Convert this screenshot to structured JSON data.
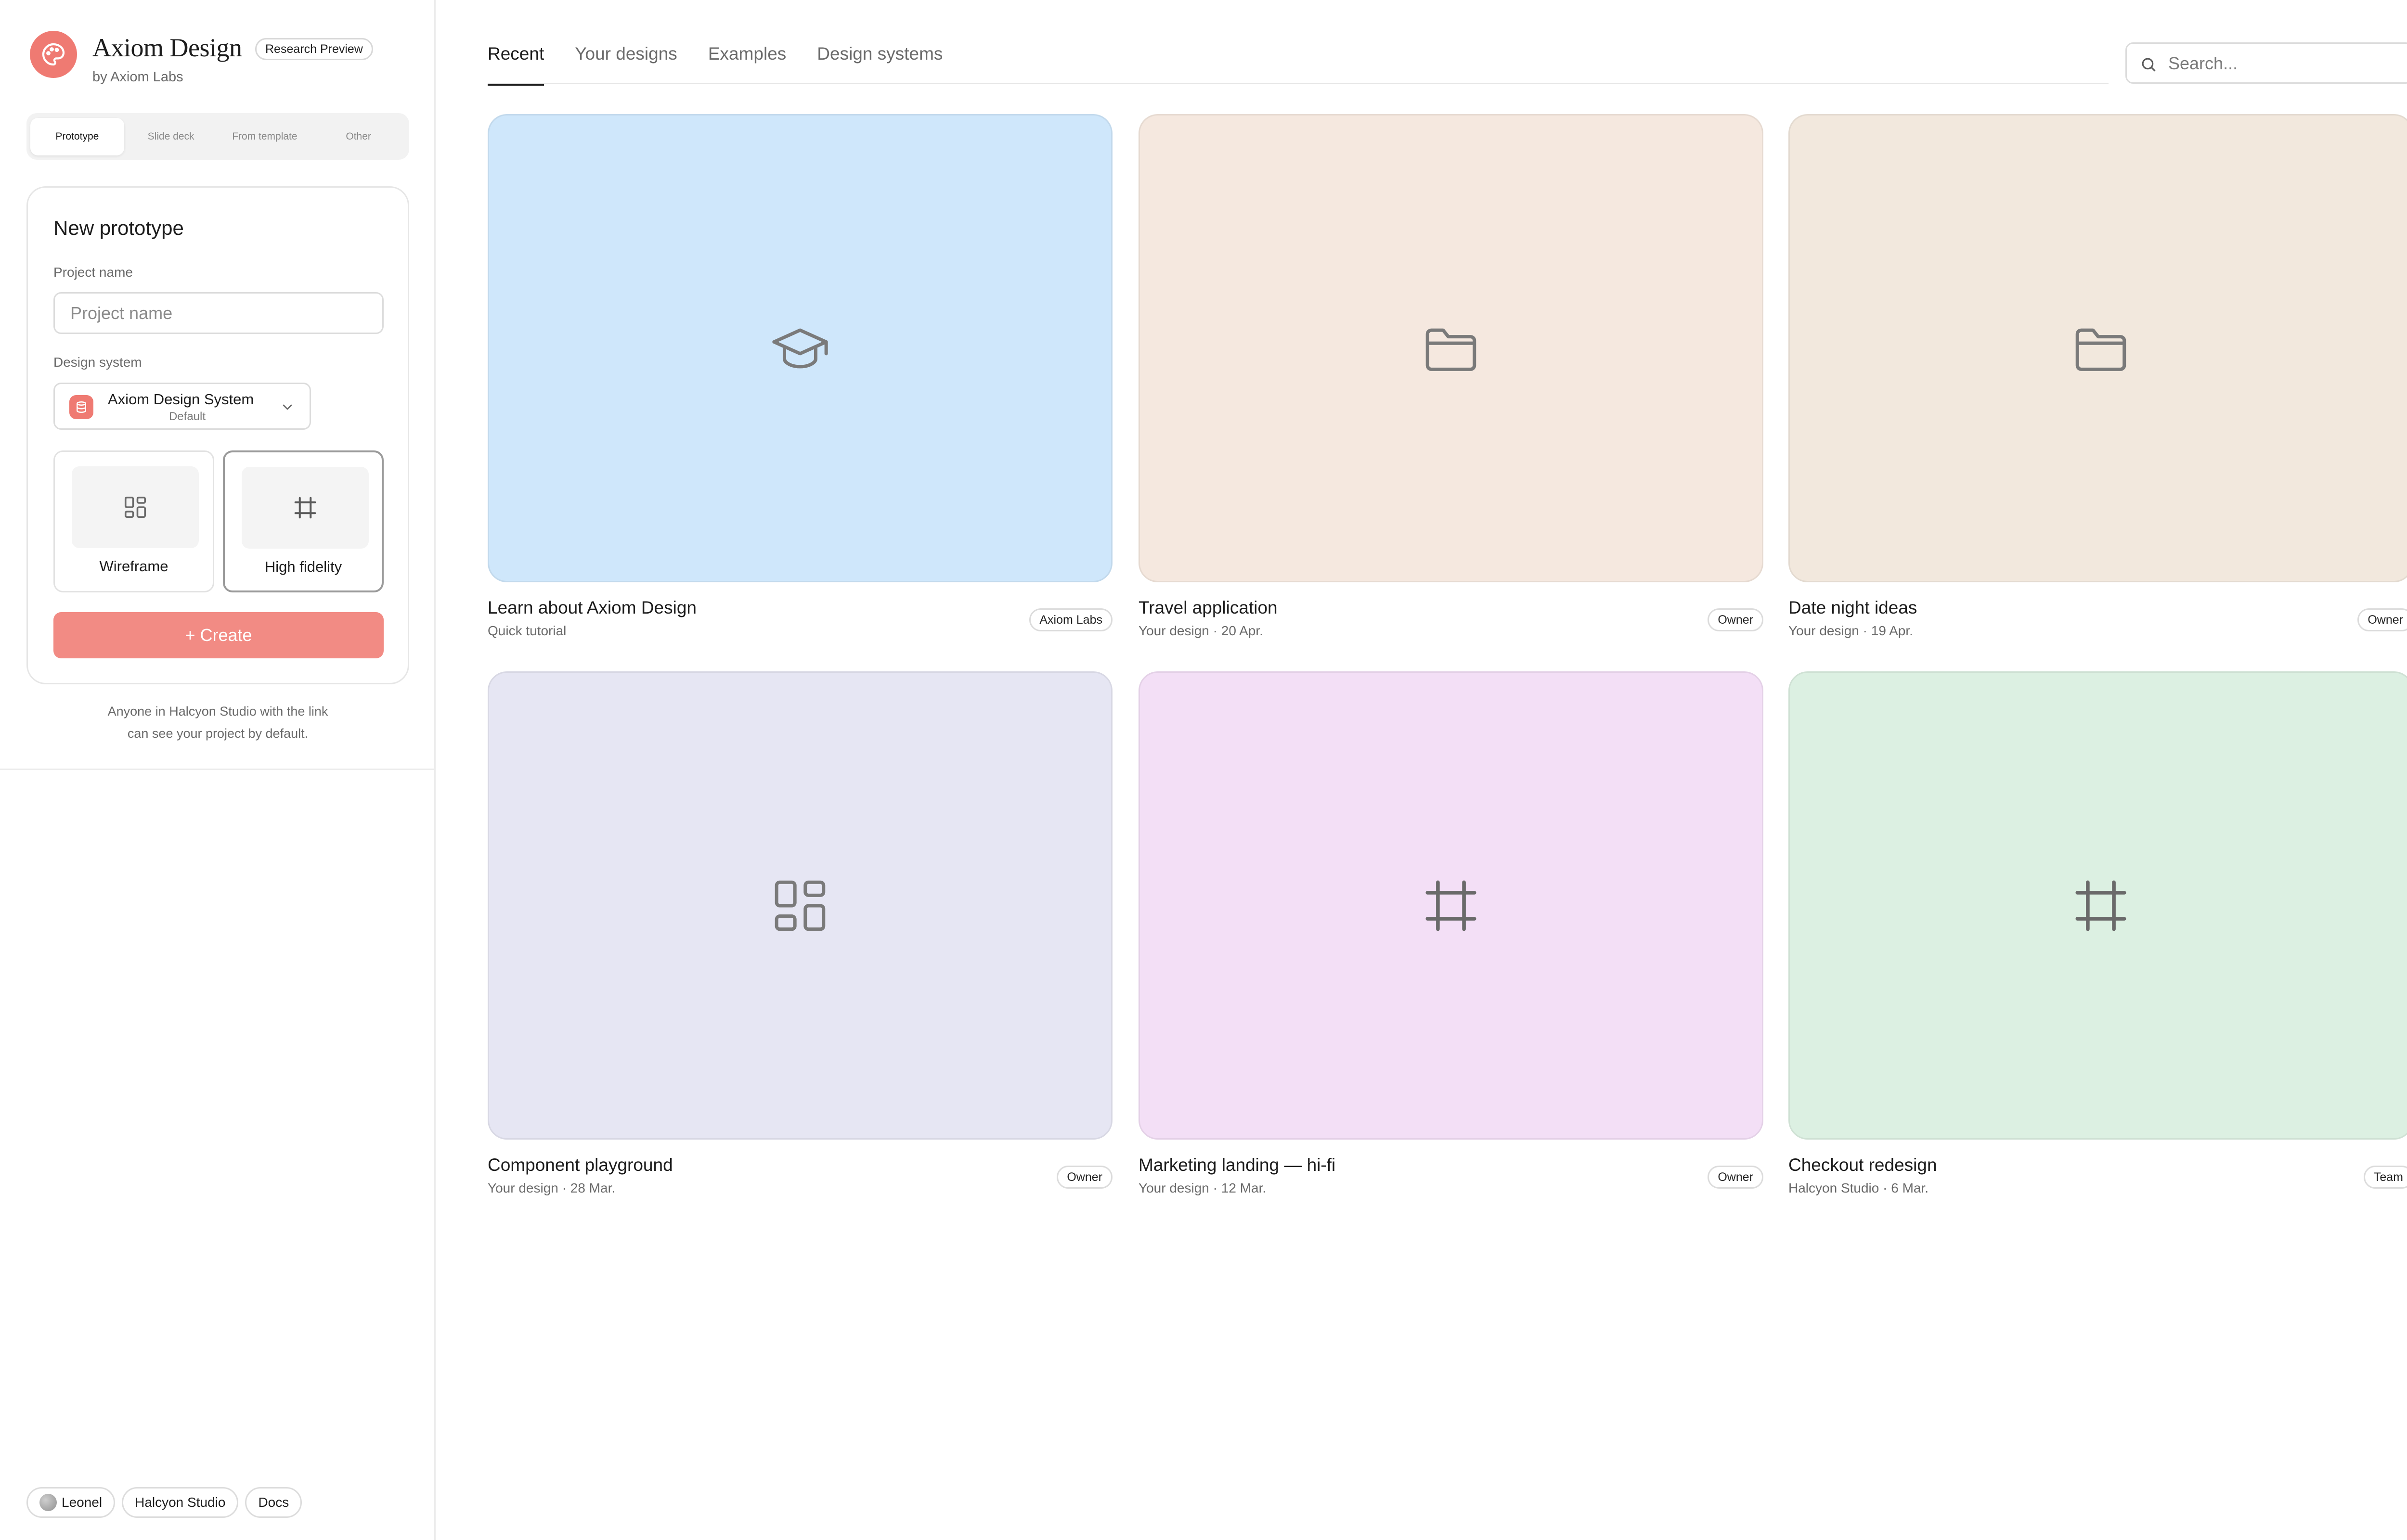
{
  "brand": {
    "name": "Axiom Design",
    "badge": "Research Preview",
    "subtitle": "by Axiom Labs",
    "accent": "#ef7a72"
  },
  "segments": [
    {
      "label": "Prototype",
      "active": true
    },
    {
      "label": "Slide deck",
      "active": false
    },
    {
      "label": "From template",
      "active": false
    },
    {
      "label": "Other",
      "active": false
    }
  ],
  "form": {
    "title": "New prototype",
    "project_label": "Project name",
    "project_placeholder": "Project name",
    "project_value": "",
    "design_system_label": "Design system",
    "design_system_name": "Axiom Design System",
    "design_system_default": "Default",
    "modes": [
      {
        "label": "Wireframe",
        "icon": "layout-grid-icon",
        "selected": false
      },
      {
        "label": "High fidelity",
        "icon": "frame-hash-icon",
        "selected": true
      }
    ],
    "create_label": "+ Create",
    "create_color": "#f28b84"
  },
  "note": {
    "line1": "Anyone in Halcyon Studio with the link",
    "line2": "can see your project by default."
  },
  "footer": {
    "user": "Leonel",
    "workspace": "Halcyon Studio",
    "docs": "Docs"
  },
  "tabs": [
    {
      "label": "Recent",
      "active": true
    },
    {
      "label": "Your designs",
      "active": false
    },
    {
      "label": "Examples",
      "active": false
    },
    {
      "label": "Design systems",
      "active": false
    }
  ],
  "search": {
    "placeholder": "Search..."
  },
  "designs": [
    {
      "title": "Learn about Axiom Design",
      "subtitle": "Quick tutorial",
      "badge": "Axiom Labs",
      "bg": "#cfe7fb",
      "icon": "graduation-cap-icon"
    },
    {
      "title": "Travel application",
      "subtitle": "Your design · 20 Apr.",
      "badge": "Owner",
      "bg": "#f5e8df",
      "icon": "folder-icon"
    },
    {
      "title": "Date night ideas",
      "subtitle": "Your design · 19 Apr.",
      "badge": "Owner",
      "bg": "#f2e8dd",
      "icon": "folder-icon"
    },
    {
      "title": "Component playground",
      "subtitle": "Your design · 28 Mar.",
      "badge": "Owner",
      "bg": "#e6e6f3",
      "icon": "layout-grid-icon"
    },
    {
      "title": "Marketing landing — hi-fi",
      "subtitle": "Your design · 12 Mar.",
      "badge": "Owner",
      "bg": "#f3dff6",
      "icon": "frame-hash-icon"
    },
    {
      "title": "Checkout redesign",
      "subtitle": "Halcyon Studio · 6 Mar.",
      "badge": "Team",
      "bg": "#dcf0e2",
      "icon": "frame-hash-icon"
    }
  ]
}
